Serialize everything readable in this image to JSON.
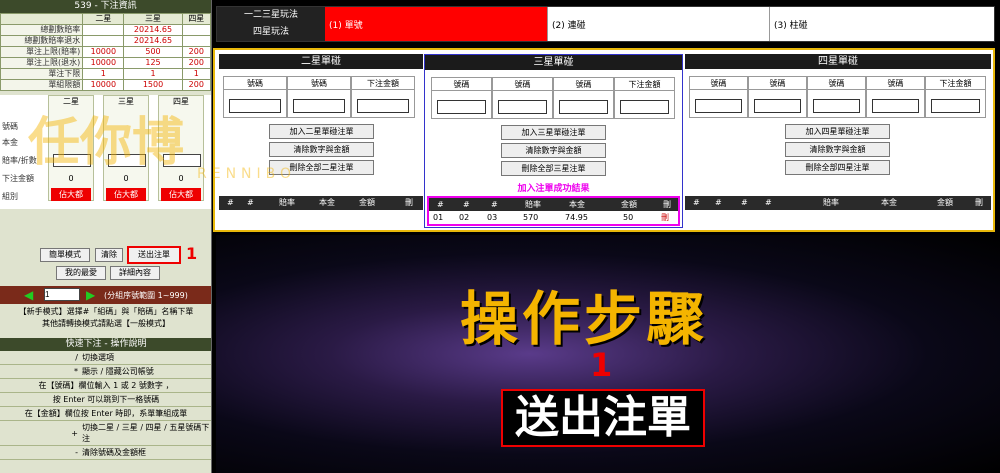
{
  "left": {
    "title": "539 - 下注資訊",
    "table_headers": [
      "",
      "二星",
      "三星",
      "四星"
    ],
    "rows": [
      {
        "label": "總劃數賠率",
        "values": [
          "",
          "20214.65",
          ""
        ],
        "color": "green"
      },
      {
        "label": "總劃數賠率退水",
        "values": [
          "",
          "20214.65",
          ""
        ],
        "color": "green"
      },
      {
        "label": "單注上限(賠率)",
        "values": [
          "10000",
          "500",
          "200"
        ]
      },
      {
        "label": "單注上限(退水)",
        "values": [
          "10000",
          "125",
          "200"
        ]
      },
      {
        "label": "單注下限",
        "values": [
          "1",
          "1",
          "1"
        ]
      },
      {
        "label": "單組限額",
        "values": [
          "10000",
          "1500",
          "200"
        ]
      }
    ],
    "mid_headers": [
      "二星",
      "三星",
      "四星"
    ],
    "mid_labels": [
      "號碼",
      "本金",
      "賠率/折數",
      "下注金額",
      "組別"
    ],
    "mid_zero": [
      "0",
      "0",
      "0"
    ],
    "mid_red": [
      "佔大都",
      "佔大都",
      "佔大都"
    ],
    "buttons": {
      "simple": "簡單模式",
      "clear": "清除",
      "submit": "送出注單",
      "annot": "1",
      "mine": "我的最愛",
      "detail": "詳細內容"
    },
    "page_value": "1",
    "page_hint": "(分組序號範圍 1~999)",
    "info_line1": "【新手模式】選擇#「組碼」與「賠碼」名稱下單",
    "info_line2": "其他請轉換模式請點選【一般模式】",
    "quick_title": "快速下注 - 操作說明",
    "quick_rows": [
      {
        "k": "/",
        "v": "切換選項"
      },
      {
        "k": "*",
        "v": "顯示 / 隱藏公司帳號"
      }
    ],
    "quick_lines": [
      "在【號碼】欄位輸入 1 或 2 號數字 ，",
      "按 Enter 可以跳到下一格號碼",
      "在【金額】欄位按 Enter 時即，系單筆組成單"
    ],
    "quick_rows2": [
      {
        "k": "+",
        "v": "切換二星 / 三星 / 四星 / 五星號碼下注"
      },
      {
        "k": "-",
        "v": "清除號碼及金額框"
      }
    ]
  },
  "top": {
    "label1": "一二三星玩法",
    "label2": "四星玩法",
    "opt1": "(1) 單號",
    "opt2": "(2) 連碰",
    "opt3": "(3) 柱碰"
  },
  "panels": [
    {
      "title": "二星單碰",
      "cols": [
        "號碼",
        "號碼",
        "下注金額"
      ],
      "buttons": [
        "加入二星單碰注單",
        "清除數字與金額",
        "刪除全部二星注單"
      ],
      "res_headers": [
        "#",
        "#",
        "賠率",
        "本金",
        "金額",
        "刪"
      ]
    },
    {
      "title": "三星單碰",
      "cols": [
        "號碼",
        "號碼",
        "號碼",
        "下注金額"
      ],
      "buttons": [
        "加入三星單碰注單",
        "清除數字與金額",
        "刪除全部三星注單"
      ],
      "success": "加入注單成功結果",
      "res_headers": [
        "#",
        "#",
        "#",
        "賠率",
        "本金",
        "金額",
        "刪"
      ],
      "res_row": [
        "01",
        "02",
        "03",
        "570",
        "74.95",
        "50",
        "刪"
      ]
    },
    {
      "title": "四星單碰",
      "cols": [
        "號碼",
        "號碼",
        "號碼",
        "號碼",
        "下注金額"
      ],
      "buttons": [
        "加入四星單碰注單",
        "清除數字與金額",
        "刪除全部四星注單"
      ],
      "res_headers": [
        "#",
        "#",
        "#",
        "#",
        "賠率",
        "本金",
        "金額",
        "刪"
      ]
    }
  ],
  "watermark": {
    "main": "任你博",
    "sub": "RENNIBO"
  },
  "steps": {
    "title": "操作步驟",
    "num": "1",
    "box": "送出注單"
  },
  "colors": {
    "accent": "#f4b400",
    "red": "#e00000",
    "frame": "#e8b80a"
  }
}
